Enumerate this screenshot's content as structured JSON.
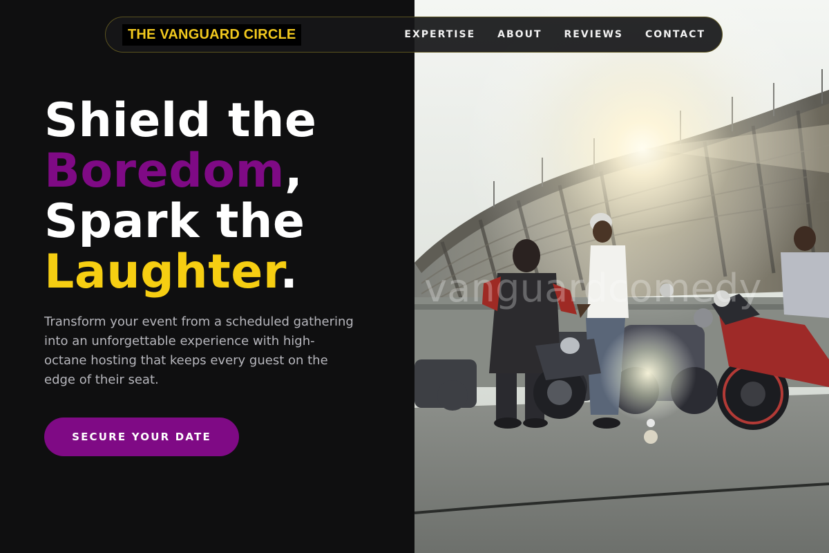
{
  "nav": {
    "brand": "THE VANGUARD CIRCLE",
    "links": [
      "EXPERTISE",
      "ABOUT",
      "REVIEWS",
      "CONTACT"
    ]
  },
  "hero": {
    "line1": "Shield the",
    "word_boredom": "Boredom",
    "comma": ",",
    "line3": "Spark the",
    "word_laughter": "Laughter",
    "period": ".",
    "subtext": "Transform your event from a scheduled gathering into an unforgettable experience with high-octane hosting that keeps every guest on the edge of their seat.",
    "cta_label": "SECURE YOUR DATE"
  },
  "image": {
    "watermark": "vanguardcomedy"
  },
  "colors": {
    "background": "#0f0f10",
    "brand_yellow": "#f2c91e",
    "accent_purple": "#7f0a85",
    "accent_yellow": "#f6ce12",
    "subtext": "#b7b7bd"
  }
}
